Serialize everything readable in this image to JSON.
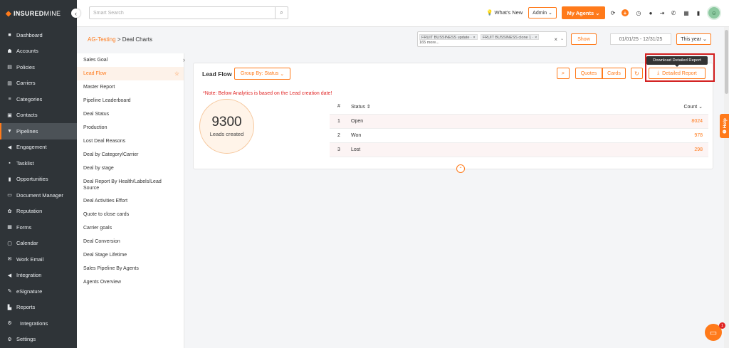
{
  "brand": {
    "logo_mark": "◆",
    "logo_bold": "INSURED",
    "logo_light": "MINE"
  },
  "sidebar": {
    "collapse_icon": "‹",
    "items": [
      {
        "label": "Dashboard",
        "icon": "■"
      },
      {
        "label": "Accounts",
        "icon": "☗"
      },
      {
        "label": "Policies",
        "icon": "▤"
      },
      {
        "label": "Carriers",
        "icon": "▥"
      },
      {
        "label": "Categories",
        "icon": "≡"
      },
      {
        "label": "Contacts",
        "icon": "▣"
      },
      {
        "label": "Pipelines",
        "icon": "▼"
      },
      {
        "label": "Engagement",
        "icon": "◀"
      },
      {
        "label": "Tasklist",
        "icon": "▪"
      },
      {
        "label": "Opportunities",
        "icon": "▮"
      },
      {
        "label": "Document Manager",
        "icon": "▭"
      },
      {
        "label": "Reputation",
        "icon": "✿"
      },
      {
        "label": "Forms",
        "icon": "▦"
      },
      {
        "label": "Calendar",
        "icon": "▢"
      },
      {
        "label": "Work Email",
        "icon": "✉"
      },
      {
        "label": "Integration",
        "icon": "◀"
      },
      {
        "label": "eSignature",
        "icon": "✎"
      },
      {
        "label": "Reports",
        "icon": "▙"
      },
      {
        "label": "Integrations",
        "icon": "⚙"
      },
      {
        "label": "Settings",
        "icon": "⚙"
      }
    ],
    "active": "Pipelines"
  },
  "topbar": {
    "search_placeholder": "Smart Search",
    "search_icon": "⌕",
    "whats_new": "What's New",
    "whats_new_icon": "💡",
    "admin_label": "Admin",
    "admin_caret": "⌄",
    "my_agents_label": "My Agents",
    "my_agents_caret": "⌄",
    "icons": [
      "⟳",
      "+",
      "◷",
      "●",
      "⇥",
      "✆",
      "▦",
      "▮"
    ]
  },
  "breadcrumb": {
    "root": "AG-Testing",
    "separator": ">",
    "current": "Deal Charts"
  },
  "filters": {
    "tags": [
      "FRUIT BUSSINESS update ·",
      "FRUIT BUSSINESS clone 1 ·"
    ],
    "tag_remove": "×",
    "more": "165 more...",
    "clear": "×",
    "dropdown": "⌄",
    "show_label": "Show",
    "date_range": "01/01/25 - 12/31/25",
    "period": "This year",
    "period_caret": "⌄"
  },
  "reports": {
    "collapse_icon": "›",
    "star_icon": "☆",
    "active": "Lead Flow",
    "items": [
      "Sales Goal",
      "Lead Flow",
      "Master Report",
      "Pipeline Leaderboard",
      "Deal Status",
      "Production",
      "Lost Deal Reasons",
      "Deal by Category/Carrier",
      "Deal by stage",
      "Deal Report By Health/Labels/Lead Source",
      "Deal Activities Effort",
      "Quote to close cards",
      "Carrier goals",
      "Deal Conversion",
      "Deal Stage Lifetime",
      "Sales Pipeline By Agents",
      "Agents Overview"
    ]
  },
  "card": {
    "title": "Lead Flow",
    "group_by": "Group By: Status",
    "group_by_caret": "⌄",
    "search_icon": "⌕",
    "quotes": "Quotes",
    "cards": "Cards",
    "refresh_icon": "↻",
    "download_icon": "⤓",
    "detailed_report": "Detailed Report",
    "tooltip": "Download Detailed Report",
    "note": "*Note: Below Analytics is based on the Lead creation date!",
    "total": "9300",
    "total_label": "Leads created",
    "expand_icon": "⌃"
  },
  "table": {
    "headers": {
      "idx": "#",
      "status": "Status ⇕",
      "count": "Count ⌄"
    },
    "rows": [
      {
        "idx": "1",
        "status": "Open",
        "count": "8024"
      },
      {
        "idx": "2",
        "status": "Won",
        "count": "978"
      },
      {
        "idx": "3",
        "status": "Lost",
        "count": "298"
      }
    ]
  },
  "help": {
    "label": "❷ Help"
  },
  "chat": {
    "icon": "▭",
    "badge": "1"
  },
  "colors": {
    "accent": "#ff7a1a",
    "sidebar": "#2f3438",
    "alert": "#e02424",
    "highlight": "#d31f1f"
  }
}
